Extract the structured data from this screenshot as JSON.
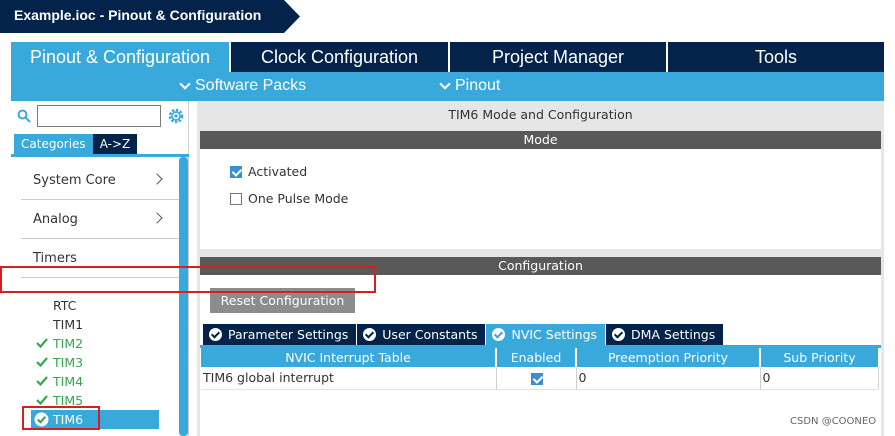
{
  "window": {
    "title": "Example.ioc - Pinout & Configuration"
  },
  "main_tabs": [
    {
      "label": "Pinout & Configuration",
      "active": true
    },
    {
      "label": "Clock Configuration",
      "active": false
    },
    {
      "label": "Project Manager",
      "active": false
    },
    {
      "label": "Tools",
      "active": false
    }
  ],
  "subnav": {
    "software_packs": "Software Packs",
    "pinout": "Pinout"
  },
  "sidebar": {
    "search": {
      "value": "",
      "placeholder": ""
    },
    "tabs": [
      {
        "label": "Categories",
        "active": true
      },
      {
        "label": "A->Z",
        "active": false
      }
    ],
    "categories": [
      {
        "label": "System Core",
        "expandable": true
      },
      {
        "label": "Analog",
        "expandable": true
      },
      {
        "label": "Timers",
        "expandable": false
      }
    ],
    "timers": [
      {
        "label": "RTC",
        "configured": false
      },
      {
        "label": "TIM1",
        "configured": false
      },
      {
        "label": "TIM2",
        "configured": true
      },
      {
        "label": "TIM3",
        "configured": true
      },
      {
        "label": "TIM4",
        "configured": true
      },
      {
        "label": "TIM5",
        "configured": true
      },
      {
        "label": "TIM6",
        "configured": true,
        "selected": true
      }
    ]
  },
  "content": {
    "title": "TIM6 Mode and Configuration",
    "mode": {
      "header": "Mode",
      "activated": {
        "label": "Activated",
        "checked": true
      },
      "one_pulse": {
        "label": "One Pulse Mode",
        "checked": false
      }
    },
    "configuration": {
      "header": "Configuration",
      "reset_button": "Reset Configuration",
      "tabs": [
        {
          "label": "Parameter Settings",
          "active": false
        },
        {
          "label": "User Constants",
          "active": false
        },
        {
          "label": "NVIC Settings",
          "active": true
        },
        {
          "label": "DMA Settings",
          "active": false
        }
      ],
      "nvic_table": {
        "columns": [
          "NVIC Interrupt Table",
          "Enabled",
          "Preemption Priority",
          "Sub Priority"
        ],
        "rows": [
          {
            "name": "TIM6 global interrupt",
            "enabled": true,
            "preemption": "0",
            "sub": "0"
          }
        ]
      }
    }
  },
  "watermark": "CSDN @COONEO",
  "colors": {
    "navy": "#03234b",
    "accent": "#39a9dc",
    "gray_bar": "#595959",
    "ok_green": "#36a64f",
    "highlight_red": "#d62020"
  }
}
